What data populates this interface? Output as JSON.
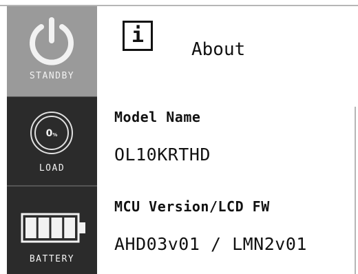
{
  "sidebar": {
    "standby": {
      "label": "STANDBY",
      "icon": "power-icon"
    },
    "load": {
      "label": "LOAD",
      "value": "0%",
      "value_number": "0",
      "value_unit": "%",
      "icon": "load-gauge-icon"
    },
    "battery": {
      "label": "BATTERY",
      "icon": "battery-icon",
      "bars": 4
    }
  },
  "header": {
    "icon": "info-icon",
    "icon_glyph": "i",
    "title": "About"
  },
  "fields": [
    {
      "label": "Model Name",
      "value": "OL10KRTHD"
    },
    {
      "label": "MCU Version/LCD FW",
      "value": "AHD03v01 / LMN2v01"
    }
  ],
  "colors": {
    "standby_bg": "#9a9a9a",
    "sidebar_bg": "#2b2b2b",
    "text": "#111111"
  }
}
